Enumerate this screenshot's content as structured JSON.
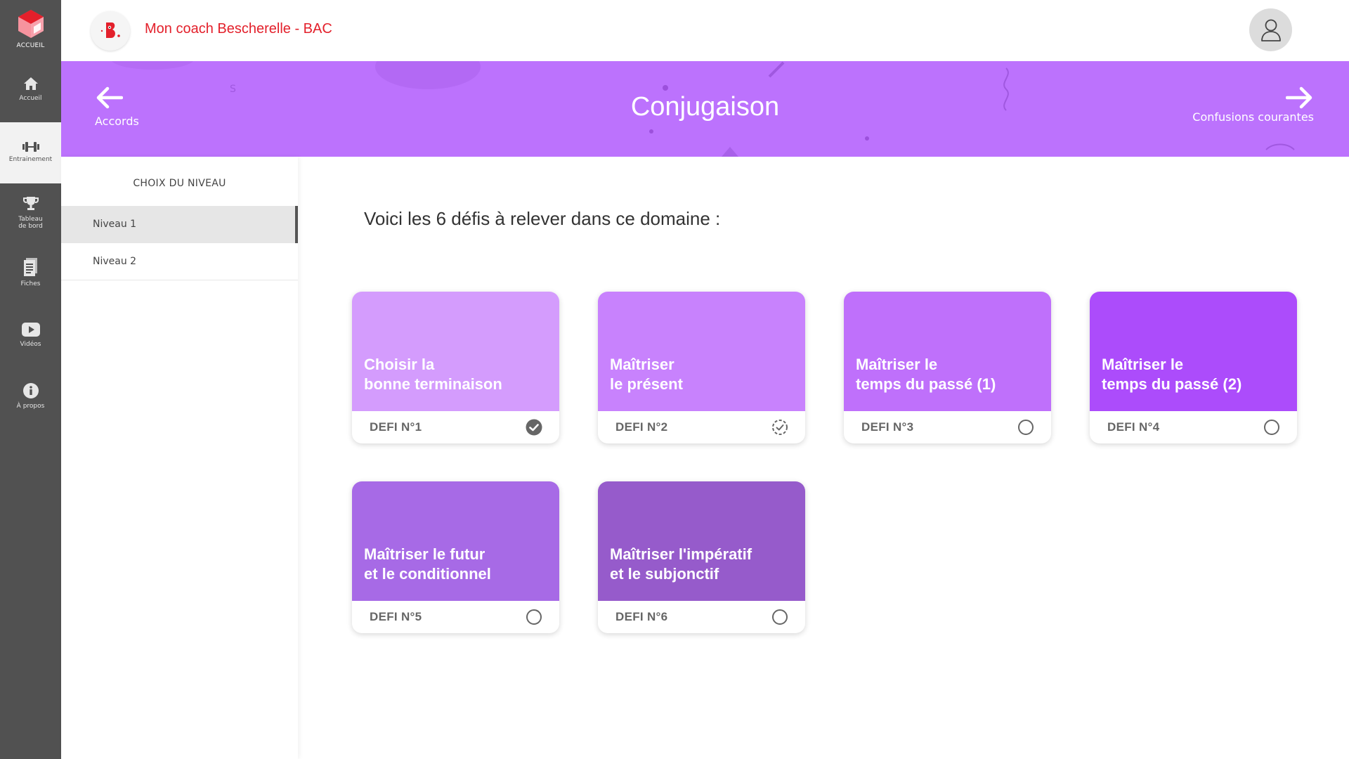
{
  "rail": {
    "logo_label": "ACCUEIL",
    "items": [
      {
        "label": "Accueil",
        "icon": "home-icon"
      },
      {
        "label": "Entrainement",
        "icon": "dumbbell-icon"
      },
      {
        "label1": "Tableau",
        "label2": "de bord",
        "icon": "trophy-icon"
      },
      {
        "label": "Fiches",
        "icon": "document-icon"
      },
      {
        "label": "Vidéos",
        "icon": "play-icon"
      },
      {
        "label": "À propos",
        "icon": "info-icon"
      }
    ]
  },
  "header": {
    "app_title": "Mon coach Bescherelle - BAC",
    "brand_color": "#e3202b"
  },
  "banner": {
    "title": "Conjugaison",
    "prev_label": "Accords",
    "next_label": "Confusions courantes",
    "color": "#bc72fd"
  },
  "levels": {
    "title": "CHOIX DU NIVEAU",
    "items": [
      {
        "label": "Niveau 1",
        "selected": true
      },
      {
        "label": "Niveau 2",
        "selected": false
      }
    ]
  },
  "main": {
    "intro": "Voici les 6 défis à relever dans ce domaine :"
  },
  "cards": [
    {
      "line1": "Choisir la",
      "line2": "bonne terminaison",
      "defi": "DEFI N°1",
      "status": "completed",
      "color": "#d49cfd"
    },
    {
      "line1": "Maîtriser",
      "line2": "le présent",
      "defi": "DEFI N°2",
      "status": "in-progress",
      "color": "#c882fd"
    },
    {
      "line1": "Maîtriser le",
      "line2": "temps du passé (1)",
      "defi": "DEFI N°3",
      "status": "not-started",
      "color": "#bf70fb"
    },
    {
      "line1": "Maîtriser le",
      "line2": "temps du passé (2)",
      "defi": "DEFI N°4",
      "status": "not-started",
      "color": "#ac4cfb"
    },
    {
      "line1": "Maîtriser le futur",
      "line2": "et le conditionnel",
      "defi": "DEFI N°5",
      "status": "not-started",
      "color": "#a76ae6"
    },
    {
      "line1": "Maîtriser l'impératif",
      "line2": "et le subjonctif",
      "defi": "DEFI N°6",
      "status": "not-started",
      "color": "#965bcb"
    }
  ]
}
